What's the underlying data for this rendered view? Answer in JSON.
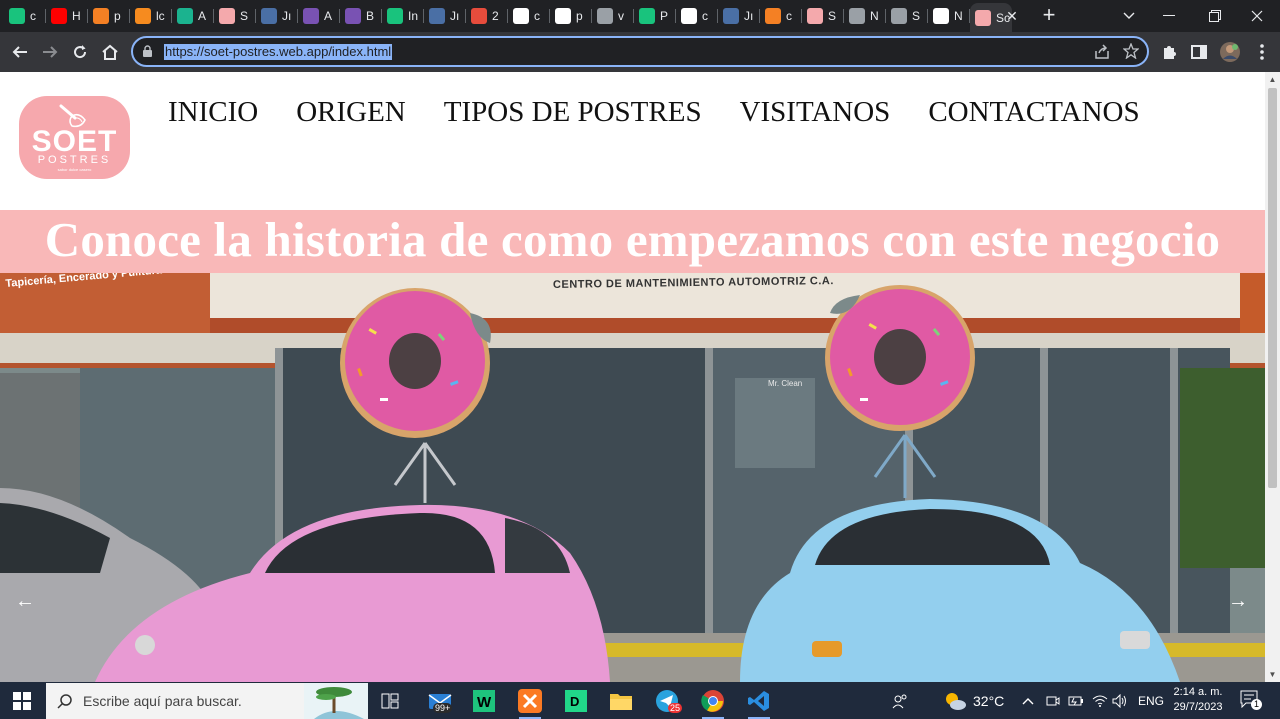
{
  "browser": {
    "tabs": [
      {
        "icon": "chatgpt-icon",
        "color": "#19c37d",
        "title": "c"
      },
      {
        "icon": "youtube-icon",
        "color": "#ff0000",
        "title": "H"
      },
      {
        "icon": "stackoverflow-icon",
        "color": "#f48024",
        "title": "p"
      },
      {
        "icon": "sourceforge-icon",
        "color": "#f68b1f",
        "title": "lc"
      },
      {
        "icon": "app-icon",
        "color": "#1bb38f",
        "title": "A"
      },
      {
        "icon": "soet-icon",
        "color": "#f4a9ac",
        "title": "S"
      },
      {
        "icon": "jupyter-icon",
        "color": "#4a6fa5",
        "title": "Jı"
      },
      {
        "icon": "bootstrap-icon",
        "color": "#7952b3",
        "title": "A"
      },
      {
        "icon": "bootstrap-icon",
        "color": "#7952b3",
        "title": "B"
      },
      {
        "icon": "chatgpt-icon",
        "color": "#19c37d",
        "title": "In"
      },
      {
        "icon": "jupyter-icon",
        "color": "#4a6fa5",
        "title": "Jı"
      },
      {
        "icon": "codecademy-icon",
        "color": "#e74c3c",
        "title": "2"
      },
      {
        "icon": "google-icon",
        "color": "#ffffff",
        "title": "c"
      },
      {
        "icon": "google-icon",
        "color": "#ffffff",
        "title": "p"
      },
      {
        "icon": "globe-icon",
        "color": "#9aa0a6",
        "title": "v"
      },
      {
        "icon": "chatgpt-icon",
        "color": "#19c37d",
        "title": "P"
      },
      {
        "icon": "google-icon",
        "color": "#ffffff",
        "title": "c"
      },
      {
        "icon": "jupyter-icon",
        "color": "#4a6fa5",
        "title": "Jı"
      },
      {
        "icon": "stackoverflow-icon",
        "color": "#f48024",
        "title": "c"
      },
      {
        "icon": "soet-icon",
        "color": "#f4a9ac",
        "title": "S"
      },
      {
        "icon": "globe-icon",
        "color": "#9aa0a6",
        "title": "N"
      },
      {
        "icon": "globe-icon",
        "color": "#9aa0a6",
        "title": "S"
      },
      {
        "icon": "github-icon",
        "color": "#ffffff",
        "title": "N"
      },
      {
        "icon": "soet-icon",
        "color": "#f4a9ac",
        "title": "Sc",
        "active": true
      }
    ],
    "tab_close": "✕",
    "new_tab": "+",
    "url": "https://soet-postres.web.app/index.html"
  },
  "site": {
    "logo": {
      "brand": "SOET",
      "sub": "POSTRES",
      "tiny": "sabor dulce casero",
      "color": "#f6a8ad"
    },
    "nav": [
      "INICIO",
      "ORIGEN",
      "TIPOS DE POSTRES",
      "VISITANOS",
      "CONTACTANOS"
    ],
    "hero_title": "Conoce la historia de como empezamos con este negocio",
    "hero_band_color": "#f9b8b8",
    "carousel": {
      "storefront_sign": "CENTRO DE MANTENIMIENTO AUTOMOTRIZ C.A.",
      "side_sign": "Tapicería, Encerado y Pulitura",
      "window_label": "Mr. Clean",
      "prev": "←",
      "next": "→"
    }
  },
  "taskbar": {
    "search_placeholder": "Escribe aquí para buscar.",
    "mail_badge": "99+",
    "telegram_badge": "25",
    "weather": "32°C",
    "language": "ENG",
    "time": "2:14 a. m.",
    "date": "29/7/2023",
    "notifications": "1"
  }
}
